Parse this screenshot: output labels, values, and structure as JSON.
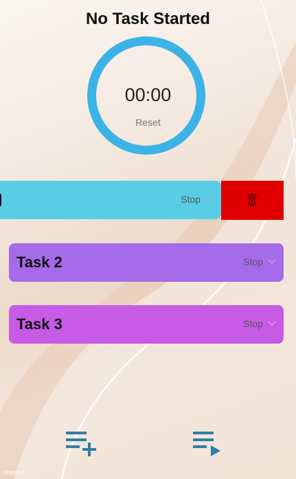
{
  "header": {
    "title": "No Task Started"
  },
  "timer": {
    "value": "00:00",
    "reset_label": "Reset"
  },
  "tasks": [
    {
      "name": "",
      "stop_label": "Stop",
      "color": "#5acde6",
      "swiped": true
    },
    {
      "name": "Task 2",
      "stop_label": "Stop",
      "color": "#a56be8",
      "swiped": false
    },
    {
      "name": "Task 3",
      "stop_label": "Stop",
      "color": "#c85be6",
      "swiped": false
    }
  ],
  "actions": {
    "delete_color": "#e00000",
    "icon_color": "#2e7fa8",
    "add_task_icon": "playlist-add-icon",
    "play_list_icon": "playlist-play-icon"
  },
  "watermark": "rawpixel"
}
